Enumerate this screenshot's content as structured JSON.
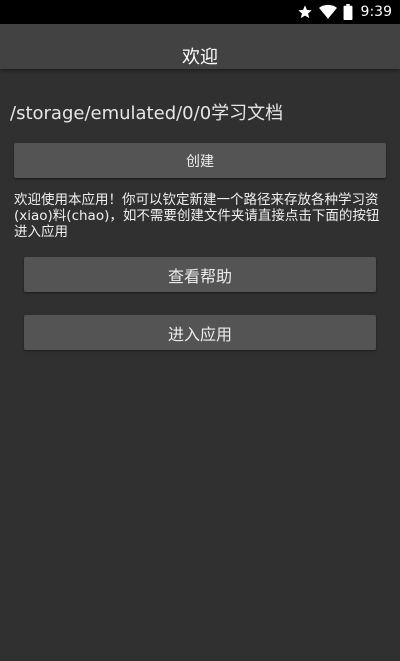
{
  "status_bar": {
    "time": "9:39",
    "icons": [
      "star-icon",
      "wifi-icon",
      "battery-icon"
    ]
  },
  "app_bar": {
    "title": "欢迎"
  },
  "main": {
    "path": "/storage/emulated/0/0学习文档",
    "create_button": "创建",
    "description": "欢迎使用本应用！你可以钦定新建一个路径来存放各种学习资(xiao)料(chao)，如不需要创建文件夹请直接点击下面的按钮进入应用",
    "help_button": "查看帮助",
    "enter_button": "进入应用"
  },
  "colors": {
    "background": "#303030",
    "app_bar": "#424242",
    "button": "#545454",
    "status_bar": "#000000"
  }
}
